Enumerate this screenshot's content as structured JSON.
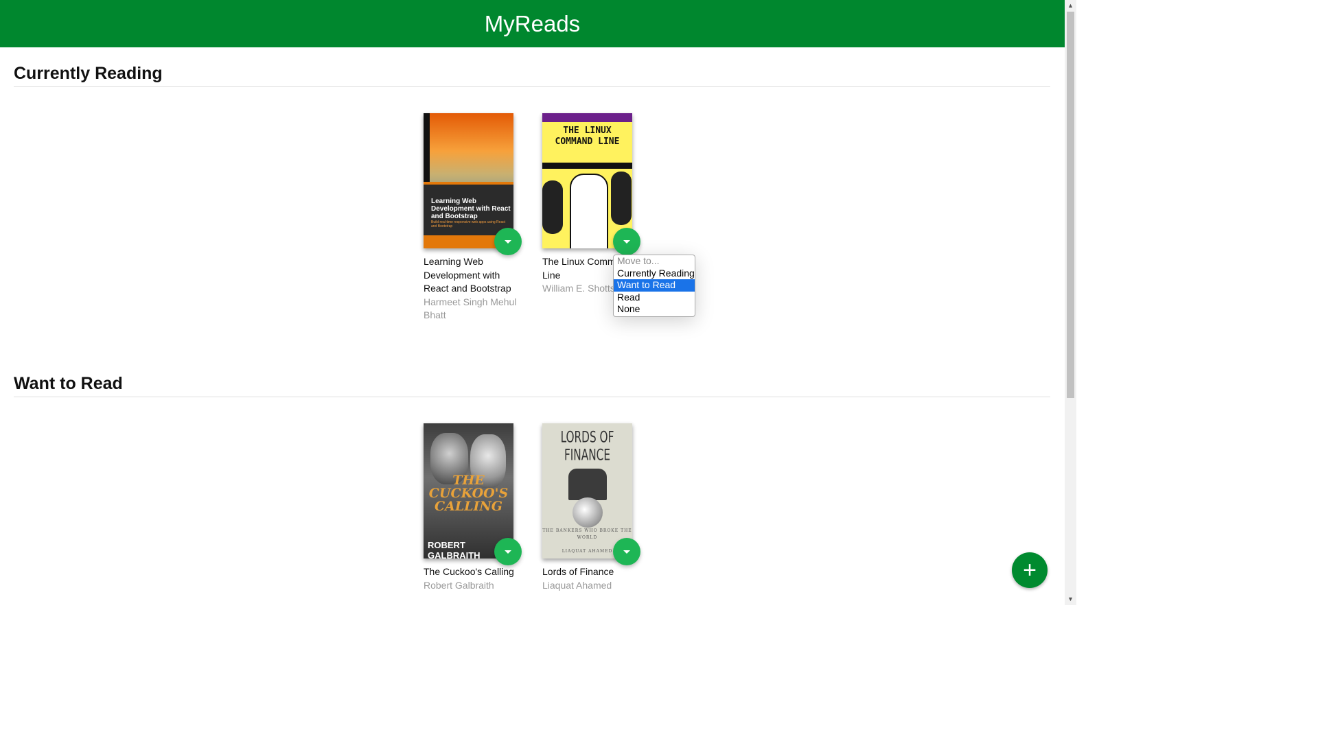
{
  "app": {
    "title": "MyReads"
  },
  "shelves": [
    {
      "title": "Currently Reading",
      "books": [
        {
          "title": "Learning Web Development with React and Bootstrap",
          "authors": "Harmeet Singh Mehul Bhatt",
          "cover": {
            "title": "Learning Web Development with React and Bootstrap",
            "subtitle": "Build real-time responsive web apps using React and Bootstrap"
          }
        },
        {
          "title": "The Linux Command Line",
          "authors": "William E. Shotts, Jr.",
          "cover": {
            "title": "THE LINUX COMMAND LINE"
          }
        }
      ]
    },
    {
      "title": "Want to Read",
      "books": [
        {
          "title": "The Cuckoo's Calling",
          "authors": "Robert Galbraith",
          "cover": {
            "title": "THE CUCKOO'S CALLING",
            "author": "ROBERT GALBRAITH"
          }
        },
        {
          "title": "Lords of Finance",
          "authors": "Liaquat Ahamed",
          "cover": {
            "title": "LORDS OF FINANCE",
            "subtitle": "THE BANKERS WHO BROKE THE WORLD",
            "author": "LIAQUAT AHAMED"
          }
        }
      ]
    }
  ],
  "shelf_menu": {
    "options": [
      "Move to...",
      "Currently Reading",
      "Want to Read",
      "Read",
      "None"
    ],
    "selected": "Want to Read"
  },
  "icons": {
    "changer": "caret-down-icon",
    "add": "plus-icon"
  },
  "colors": {
    "header": "#00872e",
    "changer": "#1eb655",
    "fab": "#008a2f",
    "selected_option": "#1a73e8"
  }
}
